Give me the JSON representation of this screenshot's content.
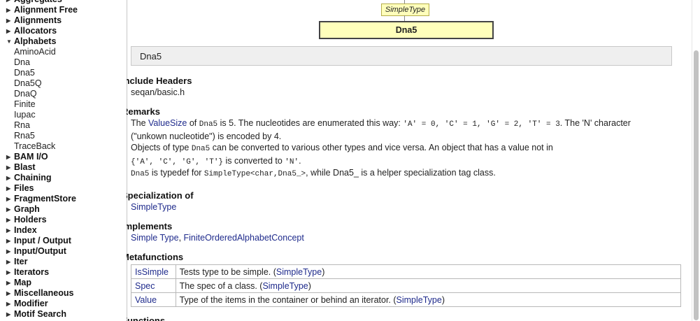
{
  "sidebar": {
    "items": [
      {
        "type": "group",
        "label": "Aggregates",
        "expanded": false
      },
      {
        "type": "group",
        "label": "Alignment Free",
        "expanded": false
      },
      {
        "type": "group",
        "label": "Alignments",
        "expanded": false
      },
      {
        "type": "group",
        "label": "Allocators",
        "expanded": false
      },
      {
        "type": "group",
        "label": "Alphabets",
        "expanded": true
      },
      {
        "type": "sub",
        "label": "AminoAcid"
      },
      {
        "type": "sub",
        "label": "Dna"
      },
      {
        "type": "sub",
        "label": "Dna5"
      },
      {
        "type": "sub",
        "label": "Dna5Q"
      },
      {
        "type": "sub",
        "label": "DnaQ"
      },
      {
        "type": "sub",
        "label": "Finite"
      },
      {
        "type": "sub",
        "label": "Iupac"
      },
      {
        "type": "sub",
        "label": "Rna"
      },
      {
        "type": "sub",
        "label": "Rna5"
      },
      {
        "type": "sub",
        "label": "TraceBack"
      },
      {
        "type": "group",
        "label": "BAM I/O",
        "expanded": false
      },
      {
        "type": "group",
        "label": "Blast",
        "expanded": false
      },
      {
        "type": "group",
        "label": "Chaining",
        "expanded": false
      },
      {
        "type": "group",
        "label": "Files",
        "expanded": false
      },
      {
        "type": "group",
        "label": "FragmentStore",
        "expanded": false
      },
      {
        "type": "group",
        "label": "Graph",
        "expanded": false
      },
      {
        "type": "group",
        "label": "Holders",
        "expanded": false
      },
      {
        "type": "group",
        "label": "Index",
        "expanded": false
      },
      {
        "type": "group",
        "label": "Input / Output",
        "expanded": false
      },
      {
        "type": "group",
        "label": "Input/Output",
        "expanded": false
      },
      {
        "type": "group",
        "label": "Iter",
        "expanded": false
      },
      {
        "type": "group",
        "label": "Iterators",
        "expanded": false
      },
      {
        "type": "group",
        "label": "Map",
        "expanded": false
      },
      {
        "type": "group",
        "label": "Miscellaneous",
        "expanded": false
      },
      {
        "type": "group",
        "label": "Modifier",
        "expanded": false
      },
      {
        "type": "group",
        "label": "Motif Search",
        "expanded": false
      }
    ]
  },
  "diagram": {
    "supertype": "SimpleType",
    "name": "Dna5"
  },
  "title": "Dna5",
  "include": {
    "heading": "Include Headers",
    "value": "seqan/basic.h"
  },
  "remarks": {
    "heading": "Remarks",
    "p1": {
      "t1": "The ",
      "link": "ValueSize",
      "t2": " of ",
      "c1": "Dna5",
      "t3": " is 5. The nucleotides are enumerated this way: ",
      "c2": "'A' = 0, 'C' = 1, 'G' = 2, 'T' = 3",
      "t4": ". The 'N' character",
      "line2": "(\"unkown nucleotide\") is encoded by 4."
    },
    "p2": {
      "t1": "Objects of type ",
      "c1": "Dna5",
      "t2": " can be converted to various other types and vice versa. An object that has a value not in",
      "c2": "{'A', 'C', 'G', 'T'}",
      "t3": " is converted to ",
      "c3": "'N'",
      "t4": "."
    },
    "p3": {
      "c1": "Dna5",
      "t1": " is typedef for ",
      "c2": "SimpleType<char,Dna5_>",
      "t2": ", while Dna5_ is a helper specialization tag class."
    }
  },
  "specialization": {
    "heading": "Specialization of",
    "link": "SimpleType"
  },
  "implements": {
    "heading": "Implements",
    "link1": "Simple Type",
    "sep": ", ",
    "link2": "FiniteOrderedAlphabetConcept"
  },
  "metafunctions": {
    "heading": "Metafunctions",
    "rows": [
      {
        "name": "IsSimple",
        "desc": "Tests type to be simple. (",
        "link": "SimpleType",
        "end": ")"
      },
      {
        "name": "Spec",
        "desc": "The spec of a class. (",
        "link": "SimpleType",
        "end": ")"
      },
      {
        "name": "Value",
        "desc": "Type of the items in the container or behind an iterator. (",
        "link": "SimpleType",
        "end": ")"
      }
    ]
  },
  "next_heading": "Functions"
}
